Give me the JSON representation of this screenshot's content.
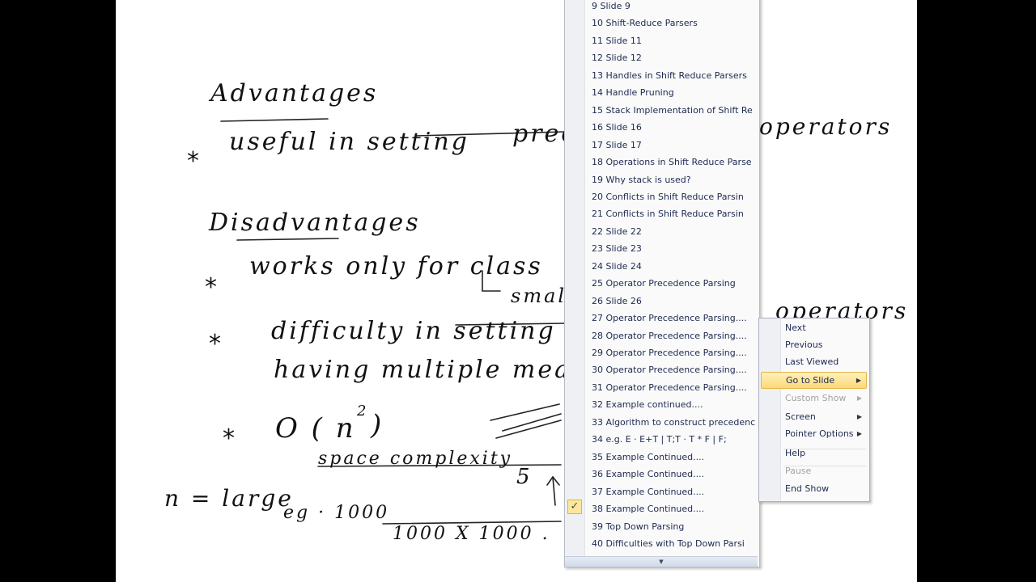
{
  "slide_notes": {
    "adv_title": "Advantages",
    "adv_1": "useful in setting",
    "adv_1_a": "precedence",
    "adv_1_b": "operators",
    "dis_title": "Disadvantages",
    "dis_1": "works only for class",
    "dis_1_sub": "small",
    "dis_2": "difficulty in setting",
    "dis_2_b": "operators",
    "dis_2_line2": "having multiple mea",
    "dis_3": "O ( n",
    "dis_3_exp": "2",
    "dis_3_close": ")",
    "space": "space complexity",
    "n_large": "n = large",
    "eg": "eg · 1000",
    "product": "1000 X 1000 .",
    "five": "5",
    "asterisk": "*"
  },
  "goto_slide_menu": {
    "items": [
      {
        "label": "9  Slide 9"
      },
      {
        "label": "10  Shift-Reduce Parsers"
      },
      {
        "label": "11  Slide 11"
      },
      {
        "label": "12  Slide 12"
      },
      {
        "label": "13  Handles in Shift Reduce Parsers"
      },
      {
        "label": "14  Handle Pruning"
      },
      {
        "label": "15  Stack Implementation of Shift Re"
      },
      {
        "label": "16  Slide 16"
      },
      {
        "label": "17  Slide 17"
      },
      {
        "label": "18  Operations in Shift Reduce Parse"
      },
      {
        "label": "19  Why stack is used?"
      },
      {
        "label": "20  Conflicts in Shift Reduce Parsin"
      },
      {
        "label": "21  Conflicts in Shift Reduce Parsin"
      },
      {
        "label": "22  Slide 22"
      },
      {
        "label": "23  Slide 23"
      },
      {
        "label": "24  Slide 24"
      },
      {
        "label": "25  Operator Precedence Parsing"
      },
      {
        "label": "26  Slide 26"
      },
      {
        "label": "27  Operator Precedence Parsing...."
      },
      {
        "label": "28  Operator Precedence Parsing...."
      },
      {
        "label": "29  Operator Precedence Parsing...."
      },
      {
        "label": "30  Operator Precedence Parsing...."
      },
      {
        "label": "31  Operator Precedence Parsing...."
      },
      {
        "label": "32  Example continued...."
      },
      {
        "label": "33  Algorithm to construct precedenc"
      },
      {
        "label": "34  e.g. E  ·  E+T | T;T  ·  T * F | F;"
      },
      {
        "label": "35  Example Continued...."
      },
      {
        "label": "36  Example Continued...."
      },
      {
        "label": "37  Example Continued...."
      },
      {
        "label": "38  Example Continued...."
      },
      {
        "label": "39  Top Down Parsing"
      },
      {
        "label": "40  Difficulties with Top Down Parsi"
      }
    ],
    "checked_item": "38  Example Continued....",
    "check_glyph": "✓",
    "scroll_down_glyph": "▼"
  },
  "context_menu": {
    "items": [
      {
        "label": "Next",
        "state": "normal",
        "submenu": false
      },
      {
        "label": "Previous",
        "state": "normal",
        "submenu": false
      },
      {
        "label": "Last Viewed",
        "state": "normal",
        "submenu": false
      },
      {
        "label": "Go to Slide",
        "state": "active",
        "submenu": true
      },
      {
        "label": "Custom Show",
        "state": "disabled",
        "submenu": true
      },
      {
        "label": "Screen",
        "state": "normal",
        "submenu": true
      },
      {
        "label": "Pointer Options",
        "state": "normal",
        "submenu": true
      },
      {
        "label": "Help",
        "state": "normal",
        "submenu": false
      },
      {
        "label": "Pause",
        "state": "disabled",
        "submenu": false
      },
      {
        "label": "End Show",
        "state": "normal",
        "submenu": false
      }
    ],
    "submenu_arrow": "▶"
  },
  "colors": {
    "background": "#000000",
    "slide": "#ffffff",
    "menu_bg": "#fafafa",
    "menu_text": "#1d2a4f",
    "highlight": "#fdd976",
    "disabled": "#a3a3a3"
  }
}
